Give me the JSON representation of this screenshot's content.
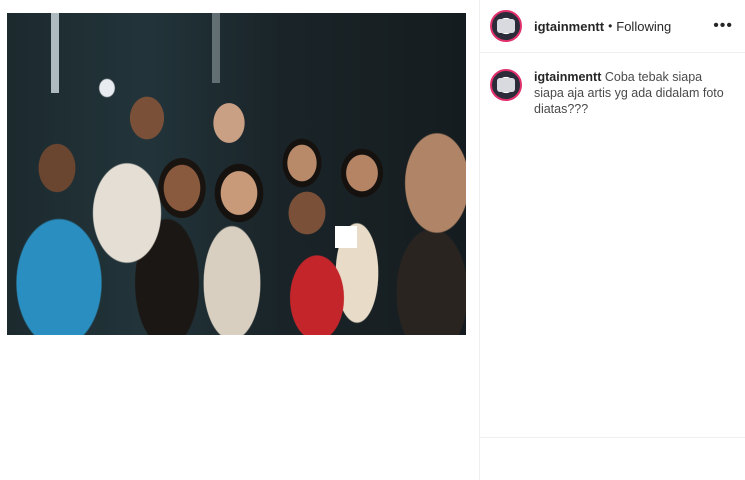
{
  "post": {
    "username": "igtainmentt",
    "separator": "•",
    "follow_status": "Following",
    "more_label": "•••"
  },
  "caption": {
    "username": "igtainmentt",
    "text": "Coba tebak siapa siapa aja artis yg ada didalam foto diatas???"
  },
  "icons": {
    "avatar": "avatar-icon",
    "more": "more-options-icon"
  },
  "colors": {
    "story_ring": "#e1306c",
    "border": "#efefef",
    "text": "#262626"
  }
}
